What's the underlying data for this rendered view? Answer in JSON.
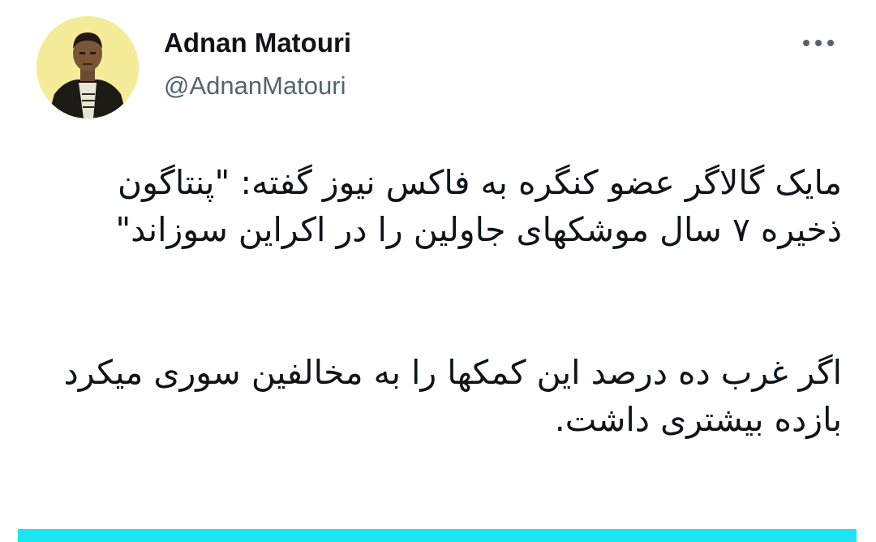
{
  "author": {
    "name": "Adnan Matouri",
    "handle": "@AdnanMatouri",
    "avatar_icon": "profile-photo"
  },
  "more_icon": "more-horizontal-icon",
  "tweet": {
    "paragraph1": "مایک گالاگر عضو کنگره به فاکس نیوز گفته: \"پنتاگون ذخیره ۷ سال موشکهای جاولین را در اکراین سوزاند\"",
    "paragraph2": "اگر غرب ده درصد این کمکها را به مخالفین سوری میکرد بازده بیشتری داشت."
  },
  "colors": {
    "text": "#0f1419",
    "secondary": "#536471",
    "avatar_bg": "#f4ec98",
    "accent_bar": "#19e6f2"
  }
}
